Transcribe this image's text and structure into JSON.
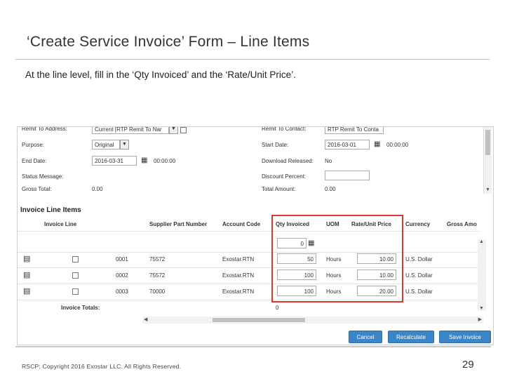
{
  "slide": {
    "title": "‘Create Service Invoice’ Form – Line Items",
    "subtitle": "At the line level, fill in the ‘Qty Invoiced’ and the ‘Rate/Unit Price’.",
    "footer": "RSCP: Copyright 2016 Exostar LLC. All Rights Reserved.",
    "page_number": "29"
  },
  "header_form": {
    "remit_to_address": {
      "label": "Remit To Address:",
      "value": "Current [RTP Remit To Nar"
    },
    "purpose": {
      "label": "Purpose:",
      "value": "Original"
    },
    "end_date": {
      "label": "End Date:",
      "date": "2016-03-31",
      "time": "00:00:00"
    },
    "status_message": {
      "label": "Status Message:"
    },
    "gross_total": {
      "label": "Gross Total:",
      "value": "0.00"
    },
    "remit_to_contact": {
      "label": "Remit To Contact:",
      "value": "RTP Remit To Conta"
    },
    "start_date": {
      "label": "Start Date:",
      "date": "2016-03-01",
      "time": "00:00:00"
    },
    "download_released": {
      "label": "Download Released:",
      "value": "No"
    },
    "discount_percent": {
      "label": "Discount Percent:",
      "value": ""
    },
    "total_amount": {
      "label": "Total Amount:",
      "value": "0.00"
    }
  },
  "line_items": {
    "section_title": "Invoice Line Items",
    "columns": {
      "invoice_line": "Invoice Line",
      "supplier_part_number": "Supplier Part Number",
      "account_code": "Account Code",
      "qty_invoiced": "Qty Invoiced",
      "uom": "UOM",
      "rate_unit_price": "Rate/Unit Price",
      "currency": "Currency",
      "gross_amount": "Gross Amo"
    },
    "filter_qty_value": "0",
    "rows": [
      {
        "line": "0001",
        "part": "75572",
        "account": "Exostar.RTN",
        "qty": "50",
        "uom": "Hours",
        "rate": "10.00",
        "currency": "U.S. Dollar"
      },
      {
        "line": "0002",
        "part": "75572",
        "account": "Exostar.RTN",
        "qty": "100",
        "uom": "Hours",
        "rate": "10.00",
        "currency": "U.S. Dollar"
      },
      {
        "line": "0003",
        "part": "70000",
        "account": "Exostar.RTN",
        "qty": "100",
        "uom": "Hours",
        "rate": "20.00",
        "currency": "U.S. Dollar"
      }
    ],
    "totals_label": "Invoice Totals:",
    "qty_total": "0"
  },
  "buttons": {
    "cancel": "Cancel",
    "recalculate": "Recalculate",
    "save_invoice": "Save Invoice"
  },
  "colors": {
    "highlight": "#d93a2b",
    "button": "#3a86c8"
  }
}
